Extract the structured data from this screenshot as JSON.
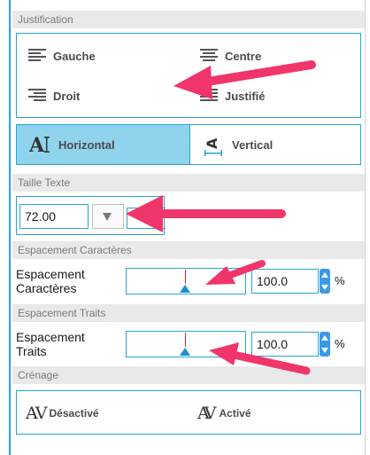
{
  "sections": {
    "justification": "Justification",
    "taille": "Taille Texte",
    "esp_car": "Espacement Caractères",
    "esp_traits": "Espacement Traits",
    "crenage": "Crénage"
  },
  "justification": {
    "gauche": "Gauche",
    "centre": "Centre",
    "droit": "Droit",
    "justifie": "Justifié"
  },
  "orientation": {
    "horizontal": "Horizontal",
    "vertical": "Vertical",
    "selected": "horizontal"
  },
  "taille": {
    "value": "72.00"
  },
  "esp_car": {
    "label_line1": "Espacement",
    "label_line2": "Caractères",
    "value": "100.0",
    "unit": "%"
  },
  "esp_traits": {
    "label_line1": "Espacement",
    "label_line2": "Traits",
    "value": "100.0",
    "unit": "%"
  },
  "crenage": {
    "desactive": "Désactivé",
    "active": "Activé"
  },
  "colors": {
    "accent": "#2aa4cf",
    "active_bg": "#8fd3ec",
    "annotation": "#f0356b",
    "thumb": "#1e8fd0",
    "tick": "#e0202a"
  },
  "icons": [
    "align-left-icon",
    "align-center-icon",
    "align-right-icon",
    "align-justify-icon",
    "text-horizontal-icon",
    "text-vertical-icon",
    "stepper-icon",
    "kerning-icon"
  ]
}
